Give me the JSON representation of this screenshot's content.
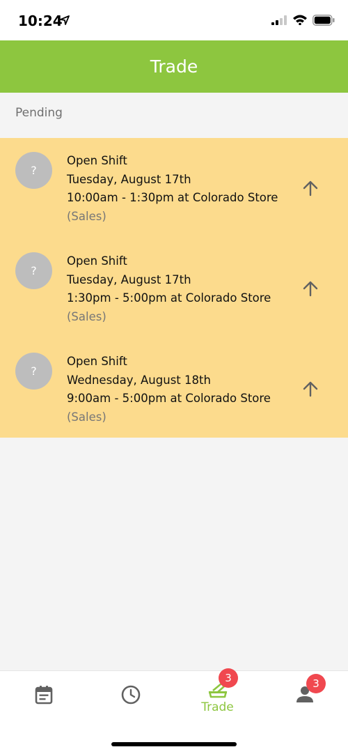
{
  "status_bar": {
    "time": "10:24"
  },
  "header": {
    "title": "Trade"
  },
  "section": {
    "label": "Pending"
  },
  "shifts": [
    {
      "avatar": "?",
      "title": "Open Shift",
      "date": "Tuesday, August 17th",
      "time": "10:00am - 1:30pm at Colorado Store",
      "role": "(Sales)"
    },
    {
      "avatar": "?",
      "title": "Open Shift",
      "date": "Tuesday, August 17th",
      "time": "1:30pm - 5:00pm at Colorado Store",
      "role": "(Sales)"
    },
    {
      "avatar": "?",
      "title": "Open Shift",
      "date": "Wednesday, August 18th",
      "time": "9:00am - 5:00pm at Colorado Store",
      "role": "(Sales)"
    }
  ],
  "tabbar": {
    "trade_label": "Trade",
    "trade_badge": "3",
    "profile_badge": "3"
  },
  "colors": {
    "accent": "#8dc63f",
    "pending_bg": "#fcdb8d",
    "badge": "#f0484f"
  }
}
